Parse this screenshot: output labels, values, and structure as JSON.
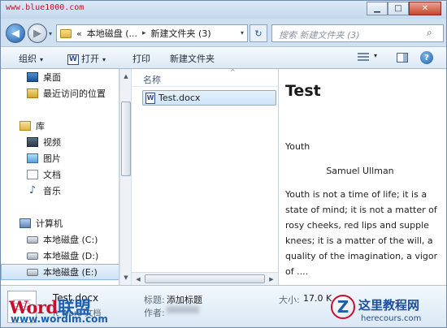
{
  "watermark": {
    "top_url": "www.blue1000.com",
    "word_logo_a": "Word",
    "word_logo_b": "联盟",
    "word_url": "www.wordlm.com",
    "site_logo_letter": "Z",
    "site_name": "这里教程网",
    "site_url": "herecours.com"
  },
  "window": {
    "minimize": "▁",
    "maximize": "□",
    "close": "✕"
  },
  "address": {
    "breadcrumb_prefix": "«",
    "crumb1": "本地磁盘 (...",
    "crumb_sep": "▸",
    "crumb2": "新建文件夹 (3)",
    "dropdown": "▾",
    "refresh_icon": "↻",
    "back_icon": "◀",
    "forward_icon": "▶",
    "nav_dropdown": "▾"
  },
  "search": {
    "placeholder": "搜索 新建文件夹 (3)",
    "icon": "⌕"
  },
  "toolbar": {
    "organize": "组织",
    "open_icon": "W",
    "open": "打开",
    "print": "打印",
    "new_folder": "新建文件夹",
    "caret": "▾",
    "help": "?"
  },
  "nav": {
    "favorites": [
      {
        "label": "桌面"
      },
      {
        "label": "最近访问的位置"
      }
    ],
    "library": {
      "label": "库"
    },
    "library_items": [
      {
        "label": "视频"
      },
      {
        "label": "图片"
      },
      {
        "label": "文档"
      },
      {
        "label": "音乐",
        "icon": "♪"
      }
    ],
    "computer": {
      "label": "计算机"
    },
    "drives": [
      {
        "label": "本地磁盘 (C:)"
      },
      {
        "label": "本地磁盘 (D:)"
      },
      {
        "label": "本地磁盘 (E:)"
      }
    ]
  },
  "files": {
    "column_name": "名称",
    "sort_indicator": "^",
    "items": [
      {
        "name": "Test.docx",
        "icon": "W"
      }
    ]
  },
  "scroll": {
    "up": "▲",
    "down": "▼",
    "left": "◀",
    "right": "▶"
  },
  "preview": {
    "title": "Test",
    "heading": "Youth",
    "author": "Samuel Ullman",
    "body": "Youth is not a time of life; it is a state of mind; it is not a matter of rosy cheeks, red lips and supple knees; it is a matter of the will, a quality of the imagination, a vigor of ...."
  },
  "details": {
    "file_name": "Test.docx",
    "file_type": "ft Word 文档",
    "title_label": "标题:",
    "title_value": "添加标题",
    "author_label": "作者:",
    "size_label": "大小:",
    "size_value": "17.0 K"
  }
}
